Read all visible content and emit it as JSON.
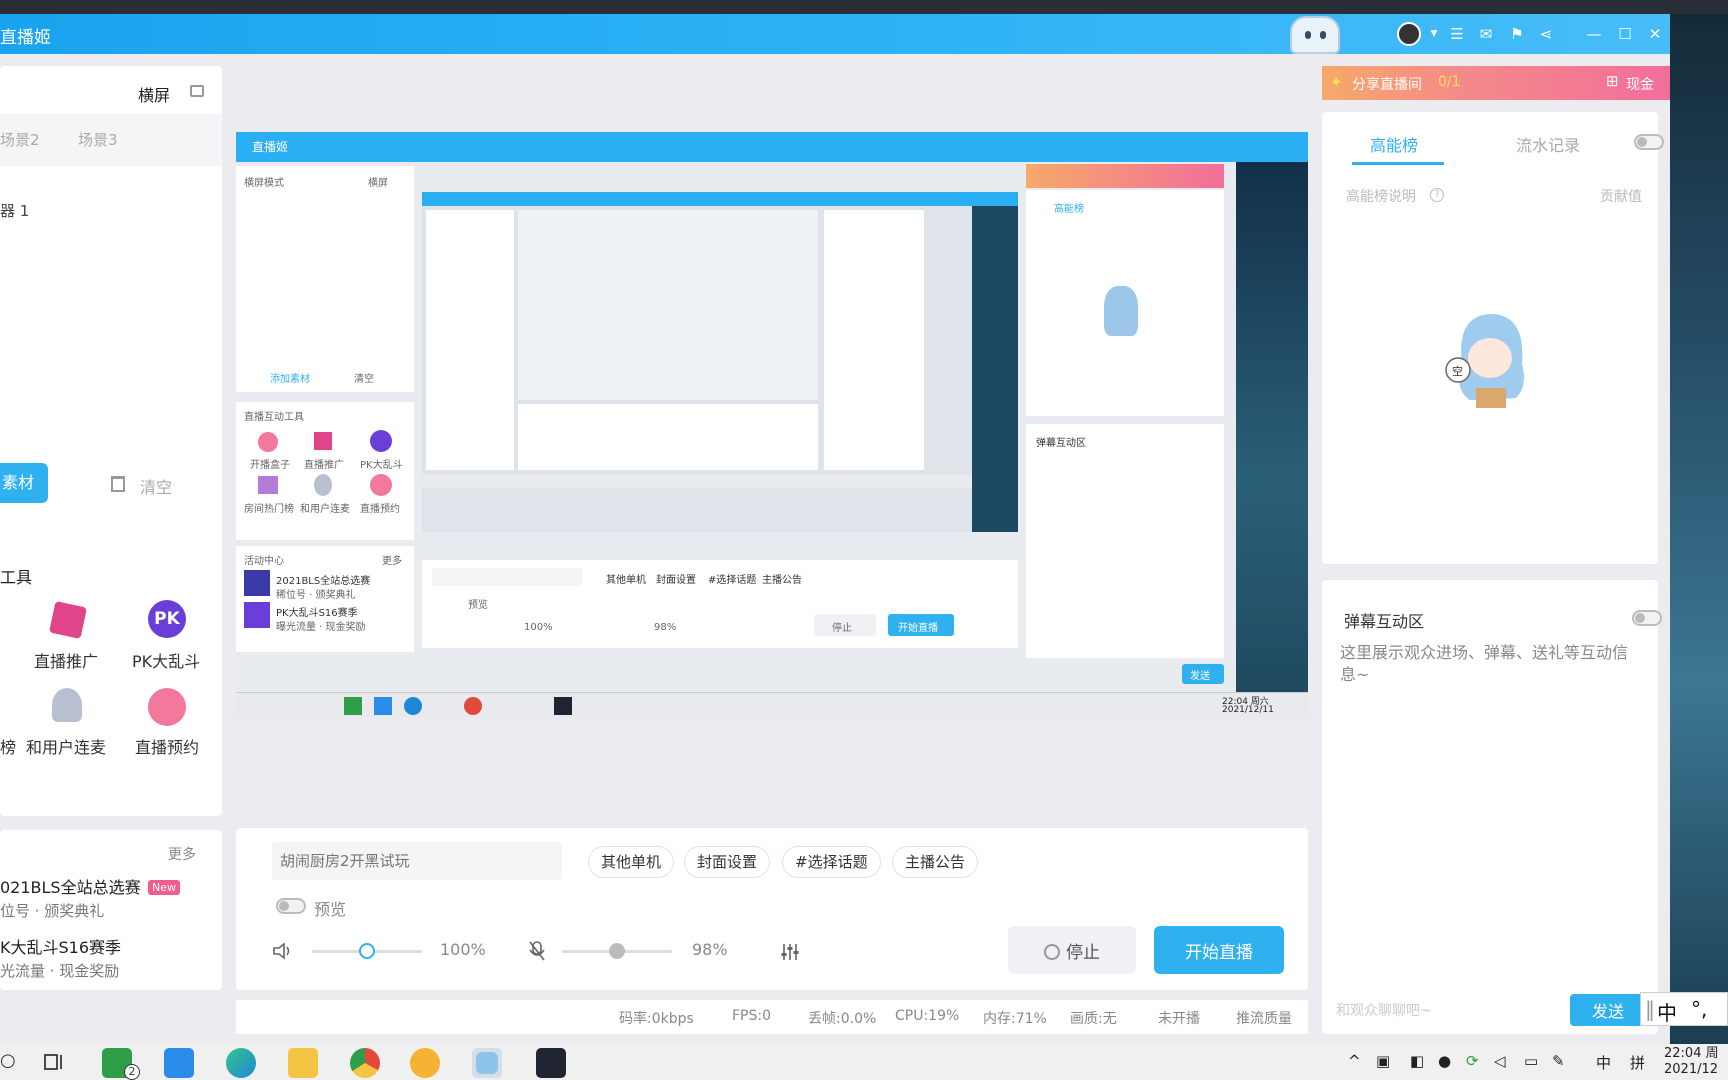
{
  "window": {
    "title": "直播姬"
  },
  "scene_panel": {
    "mode_label": "横屏",
    "tabs": [
      "场景2",
      "场景3"
    ],
    "display_item": "器 1",
    "add_material": "素材",
    "clear": "清空"
  },
  "tools_panel": {
    "title": "工具",
    "tools": [
      {
        "label": "",
        "icon": "gift-box-icon"
      },
      {
        "label": "直播推广",
        "icon": "promote-icon"
      },
      {
        "label": "PK大乱斗",
        "icon": "pk-icon"
      },
      {
        "label": "榜",
        "icon": "rank-icon"
      },
      {
        "label": "和用户连麦",
        "icon": "mic-link-icon"
      },
      {
        "label": "直播预约",
        "icon": "reservation-icon"
      }
    ]
  },
  "activity_panel": {
    "more": "更多",
    "items": [
      {
        "title": "021BLS全站总选赛",
        "badge": "New",
        "sub": "位号 · 颁奖典礼"
      },
      {
        "title": "K大乱斗S16赛季",
        "badge": "",
        "sub": "光流量 · 现金奖励"
      }
    ]
  },
  "preview": {
    "title": "直播姬",
    "texts": {
      "mode": "横屏模式",
      "landscape": "横屏",
      "tool_title": "直播互动工具",
      "add": "添加素材",
      "clear": "清空",
      "tool1": "开播盒子",
      "tool2": "直播推广",
      "tool3": "PK大乱斗",
      "tool4": "房间热门榜",
      "tool5": "和用户连麦",
      "tool6": "直播预约",
      "activity": "活动中心",
      "more": "更多",
      "act1": "2021BLS全站总选赛",
      "act1_sub": "稀位号 · 颁奖典礼",
      "act2": "PK大乱斗S16赛季",
      "act2_sub": "曝光流量 · 现金奖励",
      "chip1": "其他单机",
      "chip2": "封面设置",
      "chip3": "#选择话题",
      "chip4": "主播公告",
      "preview_label": "预览",
      "vol": "100%",
      "mic": "98%",
      "stop": "停止",
      "start": "开始直播",
      "rank": "高能榜",
      "danmaku": "弹幕互动区",
      "send": "发送",
      "clock_time": "22:04 周六",
      "clock_date": "2021/12/11"
    }
  },
  "controls": {
    "title_placeholder": "胡闹厨房2开黑试玩",
    "chips": [
      "其他单机",
      "封面设置",
      "#选择话题",
      "主播公告"
    ],
    "preview_label": "预览",
    "volume": "100%",
    "volume_level": 0.5,
    "mic_volume": "98%",
    "mic_level": 0.5,
    "stop": "停止",
    "start": "开始直播"
  },
  "status": {
    "bitrate": "码率:0kbps",
    "fps": "FPS:0",
    "drop": "丢帧:0.0%",
    "cpu": "CPU:19%",
    "memory": "内存:71%",
    "quality": "画质:无",
    "live_state": "未开播",
    "stream_quality": "推流质量"
  },
  "right": {
    "share_banner": "分享直播间",
    "share_count": "0/1",
    "cash": "现金",
    "tabs": [
      "高能榜",
      "流水记录"
    ],
    "rank_help": "高能榜说明",
    "contribution": "贡献值",
    "danmaku_title": "弹幕互动区",
    "danmaku_hint": "这里展示观众进场、弹幕、送礼等互动信息~",
    "chat_placeholder": "和观众聊聊吧~",
    "send": "发送"
  },
  "ime": {
    "lang": "中",
    "punct": "°,"
  },
  "taskbar": {
    "badge": "2",
    "tray_lang": "中",
    "tray_ime": "拼",
    "clock_time": "22:04 周",
    "clock_date": "2021/12"
  },
  "colors": {
    "accent": "#2fb1f0",
    "title_bar": "#1aa3ee",
    "pink": "#f26e9a"
  }
}
